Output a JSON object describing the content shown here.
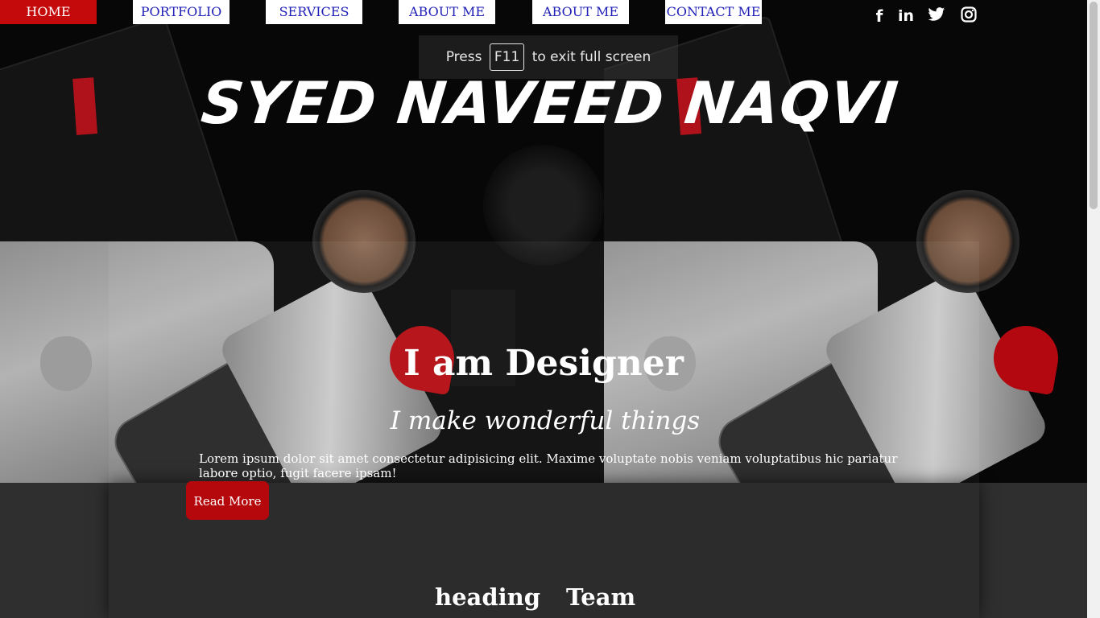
{
  "nav": {
    "items": [
      {
        "label": "HOME",
        "active": true
      },
      {
        "label": "PORTFOLIO",
        "active": false
      },
      {
        "label": "SERVICES",
        "active": false
      },
      {
        "label": "ABOUT ME",
        "active": false
      },
      {
        "label": "ABOUT ME",
        "active": false
      },
      {
        "label": "CONTACT ME",
        "active": false
      }
    ]
  },
  "social": {
    "icons": [
      "facebook-icon",
      "linkedin-icon",
      "twitter-icon",
      "instagram-icon"
    ],
    "facebook": "f",
    "linkedin": "in",
    "twitter": "🐦",
    "instagram": "◎"
  },
  "fullscreen_tip": {
    "before": "Press",
    "key": "F11",
    "after": "to exit full screen"
  },
  "hero": {
    "site_title": "SYED NAVEED NAQVI",
    "heading": "I am Designer",
    "subheading": "I make wonderful things",
    "text": "Lorem ipsum dolor sit amet consectetur adipisicing elit. Maxime voluptate nobis veniam voluptatibus hic pariatur labore optio, fugit facere ipsam!",
    "button": "Read More"
  },
  "section": {
    "headings": [
      "heading",
      "Team"
    ]
  },
  "colors": {
    "active_nav": "#c40a0a",
    "nav_text": "#2121b8",
    "button": "#b5080c",
    "panel": "#2c2c2c"
  }
}
